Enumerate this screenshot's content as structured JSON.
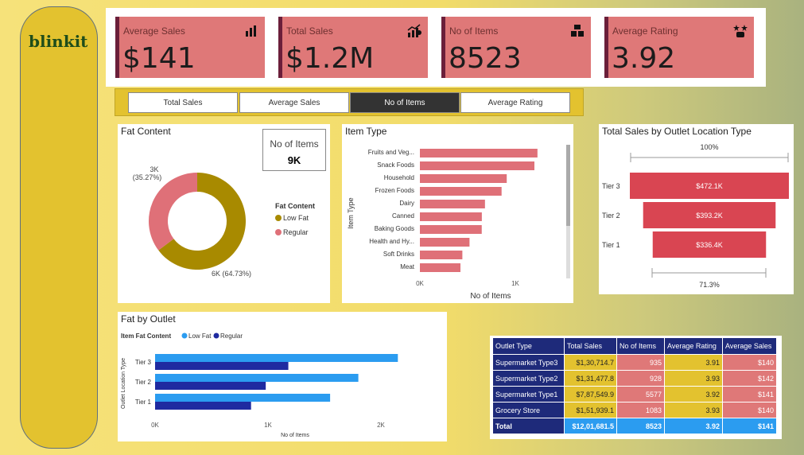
{
  "brand": {
    "logo": "blinkit"
  },
  "kpis": [
    {
      "label": "Average Sales",
      "value": "$141",
      "icon": "bar-chart-icon"
    },
    {
      "label": "Total Sales",
      "value": "$1.2M",
      "icon": "growth-chart-icon"
    },
    {
      "label": "No of Items",
      "value": "8523",
      "icon": "boxes-icon"
    },
    {
      "label": "Average Rating",
      "value": "3.92",
      "icon": "rating-hands-icon"
    }
  ],
  "slicer": {
    "options": [
      "Total Sales",
      "Average Sales",
      "No of Items",
      "Average Rating"
    ],
    "selected": "No of Items"
  },
  "fat_content": {
    "title": "Fat Content",
    "card_label": "No of Items",
    "card_value": "9K",
    "legend_title": "Fat Content",
    "low_label_line1": "6K (64.73%)",
    "reg_label_line1": "3K",
    "reg_label_line2": "(35.27%)"
  },
  "item_type": {
    "title": "Item Type",
    "y_axis_label": "Item Type",
    "x_axis_label": "No of Items"
  },
  "outlet_location": {
    "title": "Total Sales by Outlet Location Type",
    "top_pct": "100%",
    "bottom_pct": "71.3%"
  },
  "fat_by_outlet": {
    "title": "Fat by Outlet",
    "legend_title": "Item Fat Content",
    "y_axis_label": "Outlet Location Type",
    "x_axis_label": "No of Items"
  },
  "outlet_table": {
    "headers": [
      "Outlet Type",
      "Total Sales",
      "No of Items",
      "Average Rating",
      "Average Sales"
    ],
    "rows": [
      [
        "Supermarket Type3",
        "$1,30,714.7",
        "935",
        "3.91",
        "$140"
      ],
      [
        "Supermarket Type2",
        "$1,31,477.8",
        "928",
        "3.93",
        "$142"
      ],
      [
        "Supermarket Type1",
        "$7,87,549.9",
        "5577",
        "3.92",
        "$141"
      ],
      [
        "Grocery Store",
        "$1,51,939.1",
        "1083",
        "3.93",
        "$140"
      ]
    ],
    "total": [
      "Total",
      "$12,01,681.5",
      "8523",
      "3.92",
      "$141"
    ]
  },
  "chart_data": [
    {
      "type": "pie",
      "title": "Fat Content",
      "donut": true,
      "categories": [
        "Low Fat",
        "Regular"
      ],
      "values": [
        64.73,
        35.27
      ],
      "data_labels": [
        "6K (64.73%)",
        "3K (35.27%)"
      ],
      "colors": [
        "#a88a00",
        "#df7078"
      ],
      "legend": "right"
    },
    {
      "type": "bar",
      "orientation": "horizontal",
      "title": "Item Type",
      "ylabel": "Item Type",
      "xlabel": "No of Items",
      "categories": [
        "Fruits and Veg...",
        "Snack Foods",
        "Household",
        "Frozen Foods",
        "Dairy",
        "Canned",
        "Baking Goods",
        "Health and Hy...",
        "Soft Drinks",
        "Meat"
      ],
      "values": [
        1232,
        1200,
        910,
        856,
        682,
        649,
        648,
        520,
        445,
        425
      ],
      "xlim": [
        0,
        1300
      ],
      "xticks": [
        "0K",
        "1K"
      ],
      "color": "#df7078"
    },
    {
      "type": "bar",
      "orientation": "horizontal",
      "funnel": true,
      "title": "Total Sales by Outlet Location Type",
      "categories": [
        "Tier 3",
        "Tier 2",
        "Tier 1"
      ],
      "values": [
        472.1,
        393.2,
        336.4
      ],
      "value_labels": [
        "$472.1K",
        "$393.2K",
        "$336.4K"
      ],
      "color": "#d94552"
    },
    {
      "type": "bar",
      "orientation": "horizontal",
      "title": "Fat by Outlet",
      "ylabel": "Outlet Location Type",
      "xlabel": "No of Items",
      "categories": [
        "Tier 3",
        "Tier 2",
        "Tier 1"
      ],
      "series": [
        {
          "name": "Low Fat",
          "values": [
            2150,
            1800,
            1550
          ],
          "color": "#2b9cf0"
        },
        {
          "name": "Regular",
          "values": [
            1180,
            980,
            850
          ],
          "color": "#1f2aa0"
        }
      ],
      "xlim": [
        0,
        2300
      ],
      "xticks": [
        "0K",
        "1K",
        "2K"
      ]
    }
  ]
}
